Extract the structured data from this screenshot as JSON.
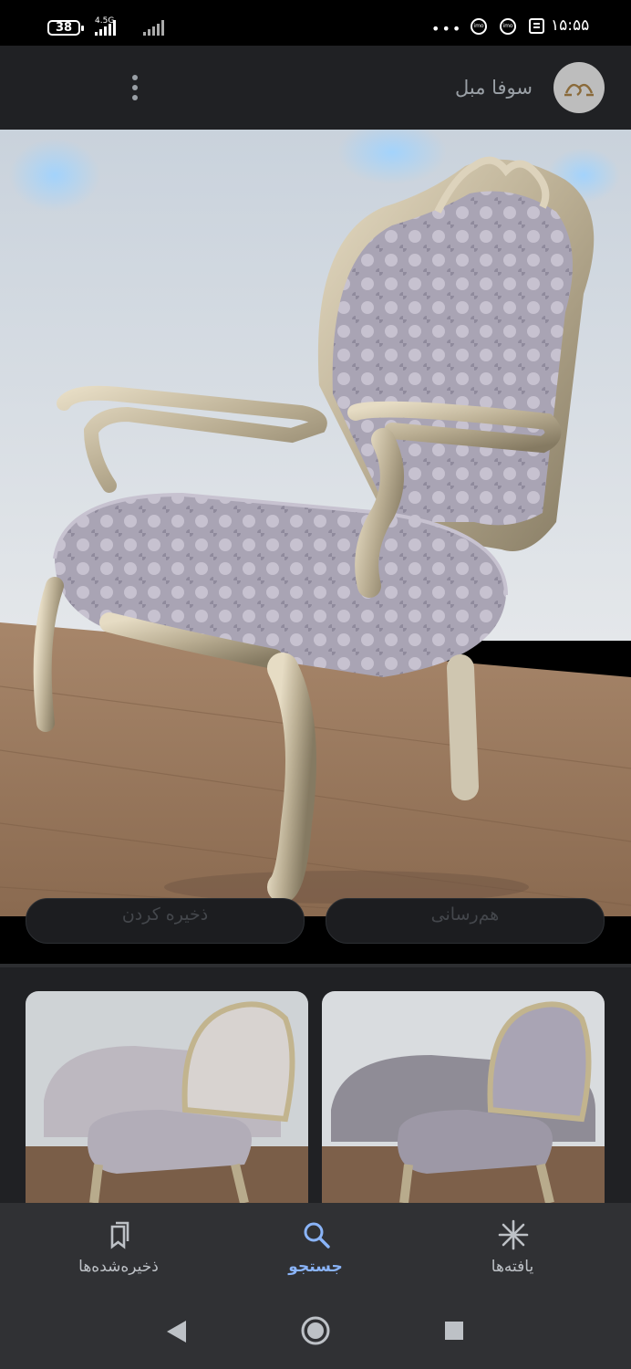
{
  "status_bar": {
    "battery": "38",
    "network": "4.5G",
    "dots": "•••",
    "clock": "۱۵:۵۵",
    "icons": [
      "imo-icon",
      "imo-icon",
      "news-icon"
    ]
  },
  "header": {
    "site_name": "سوفا مبل",
    "menu_icon": "kebab-menu-icon"
  },
  "image_actions": {
    "save_label": "ذخیره کردن",
    "share_label": "هم‌رسانی"
  },
  "bottom_nav": {
    "items": [
      {
        "label": "ذخیره‌شده‌ها",
        "icon": "bookmarks-icon",
        "active": false
      },
      {
        "label": "جستجو",
        "icon": "search-icon",
        "active": true
      },
      {
        "label": "یافته‌ها",
        "icon": "discover-icon",
        "active": false
      }
    ]
  },
  "colors": {
    "accent": "#8ab4f8",
    "nav_bg": "#303134",
    "header_bg": "#202124"
  }
}
